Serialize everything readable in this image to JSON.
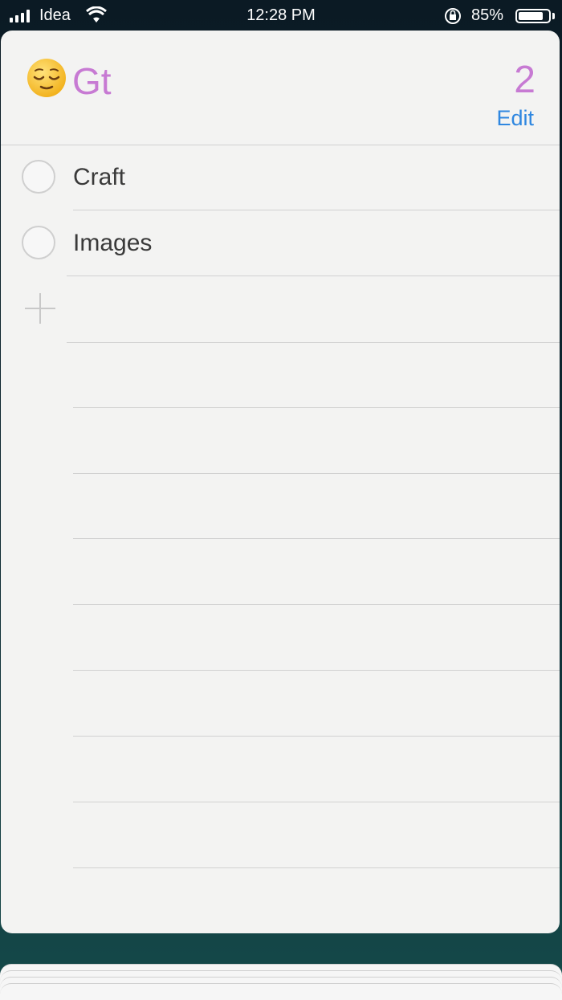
{
  "status_bar": {
    "carrier": "Idea",
    "time": "12:28 PM",
    "battery_percent": "85%",
    "battery_level": 0.85
  },
  "list": {
    "emoji_icon": "relieved-face-emoji",
    "title": "Gt",
    "count": "2",
    "edit_label": "Edit",
    "accent_color": "#c77ad3",
    "link_color": "#2f87e0",
    "items": [
      {
        "label": "Craft",
        "completed": false
      },
      {
        "label": "Images",
        "completed": false
      }
    ],
    "add_icon": "plus-icon"
  }
}
